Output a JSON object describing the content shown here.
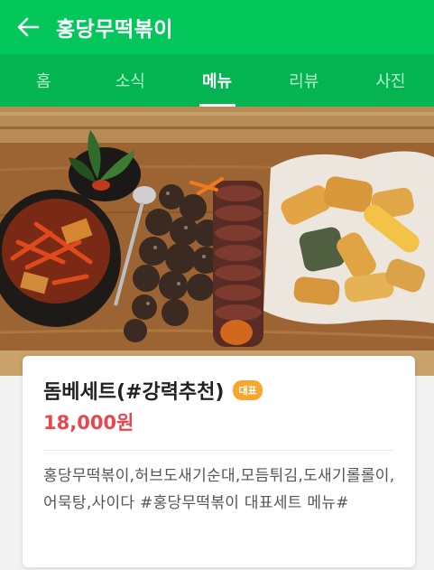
{
  "header": {
    "title": "홍당무떡볶이"
  },
  "tabs": [
    {
      "label": "홈"
    },
    {
      "label": "소식"
    },
    {
      "label": "메뉴"
    },
    {
      "label": "리뷰"
    },
    {
      "label": "사진"
    }
  ],
  "active_tab": "메뉴",
  "menu": {
    "name": "돔베세트(#강력추천)",
    "badge": "대표",
    "price": "18,000원",
    "description": "홍당무떡볶이,허브도새기순대,모듬튀김,도새기롤롤이,어묵탕,사이다 #홍당무떡볶이 대표세트 메뉴#"
  },
  "colors": {
    "brand": "#03c75a",
    "tab_bar": "#03b451",
    "price": "#e8474f",
    "badge": "#f7a72d"
  }
}
